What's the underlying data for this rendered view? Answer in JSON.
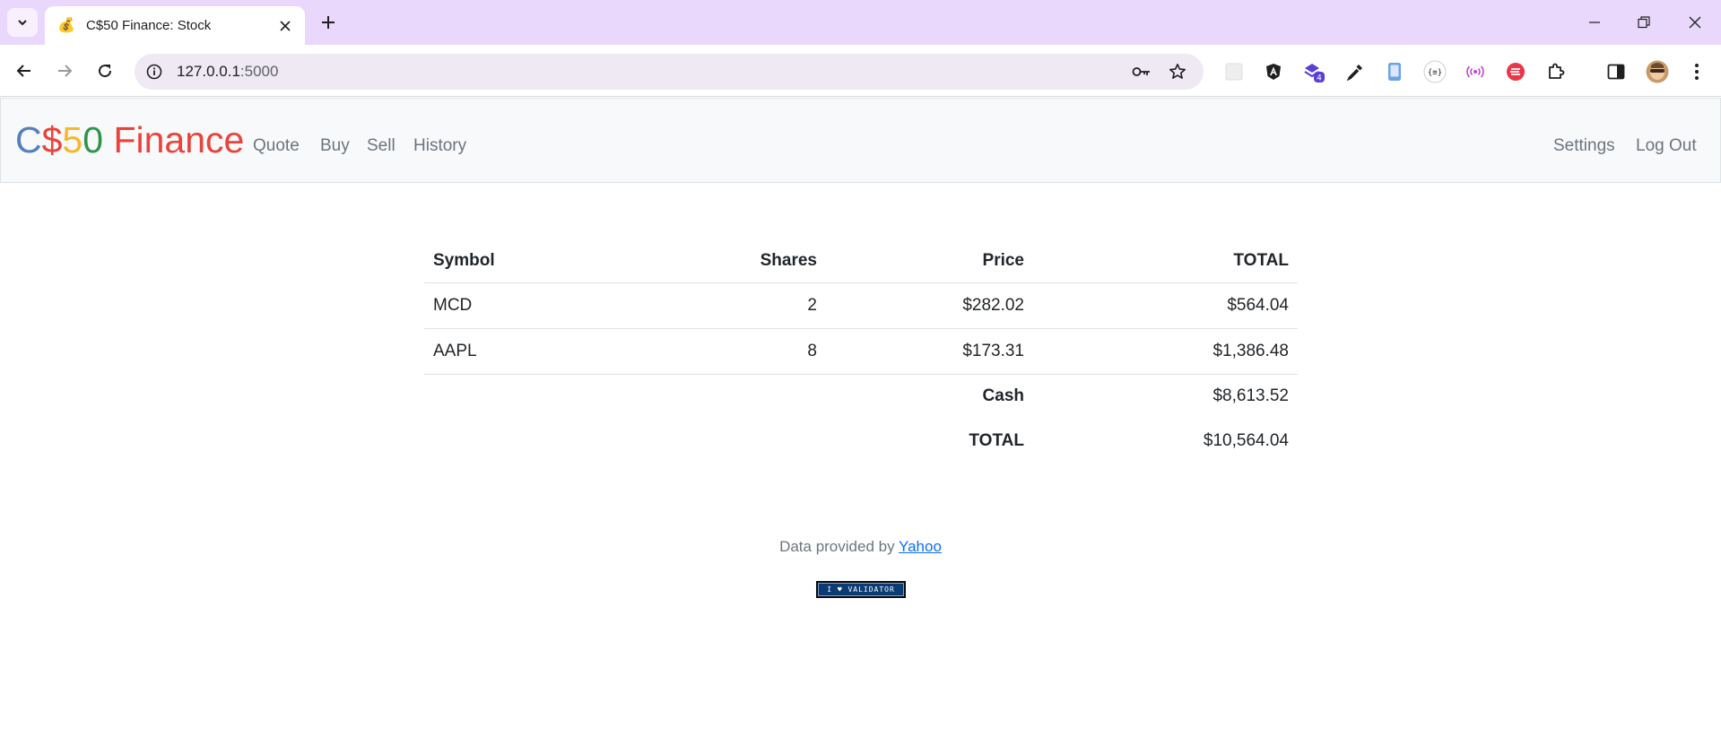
{
  "browser": {
    "tab_title": "C$50 Finance: Stock",
    "tab_favicon": "💰",
    "url_host": "127.0.0.1",
    "url_port": ":5000",
    "extension_badge": "4"
  },
  "icons": {
    "tab_search": "chevron-down-icon",
    "tab_close": "close-icon",
    "new_tab": "plus-icon",
    "minimize": "minimize-icon",
    "restore": "restore-icon",
    "window_close": "close-icon",
    "back": "arrow-left-icon",
    "forward": "arrow-right-icon",
    "reload": "reload-icon",
    "site_info": "info-icon",
    "password": "key-icon",
    "bookmark": "star-icon",
    "extensions": "puzzle-icon",
    "side_panel": "side-panel-icon",
    "profile": "avatar-icon",
    "menu": "kebab-menu-icon"
  },
  "navbar": {
    "brand": {
      "c": "C",
      "dollar": "$",
      "five": "5",
      "zero": "0",
      "finance": " Finance"
    },
    "links": [
      "Quote",
      "Buy",
      "Sell",
      "History"
    ],
    "right_links": [
      "Settings",
      "Log Out"
    ]
  },
  "colors": {
    "brand_blue": "#537fbe",
    "brand_red": "#ea433b",
    "brand_yellow": "#f5b82e",
    "brand_green": "#2e944b",
    "link": "#0d6efd"
  },
  "table": {
    "headers": [
      "Symbol",
      "Shares",
      "Price",
      "TOTAL"
    ],
    "rows": [
      {
        "symbol": "MCD",
        "shares": "2",
        "price": "$282.02",
        "total": "$564.04"
      },
      {
        "symbol": "AAPL",
        "shares": "8",
        "price": "$173.31",
        "total": "$1,386.48"
      }
    ],
    "cash_label": "Cash",
    "cash_value": "$8,613.52",
    "grand_total_label": "TOTAL",
    "grand_total_value": "$10,564.04"
  },
  "footer": {
    "prefix": "Data provided by",
    "link": "Yahoo",
    "validator_badge": "I ♥ VALIDATOR"
  }
}
